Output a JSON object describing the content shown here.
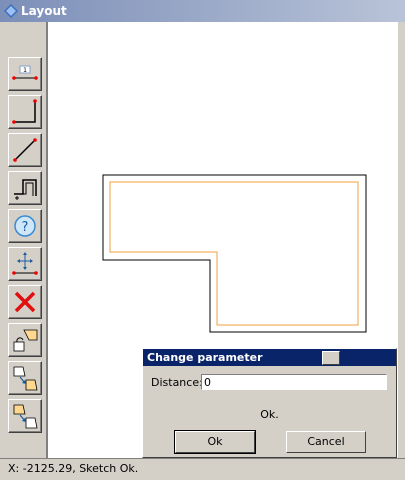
{
  "window": {
    "title": "Layout"
  },
  "toolbar": {
    "tools": [
      {
        "name": "dimension-tool-icon"
      },
      {
        "name": "corner-line-icon"
      },
      {
        "name": "diagonal-line-icon"
      },
      {
        "name": "step-shape-icon"
      },
      {
        "name": "help-icon"
      },
      {
        "name": "move-dimension-icon"
      },
      {
        "name": "delete-icon"
      },
      {
        "name": "shape-rotate-icon"
      },
      {
        "name": "shape-transfer-down-icon"
      },
      {
        "name": "shape-transfer-up-icon"
      }
    ],
    "dimension_badge": "1"
  },
  "dialog": {
    "title": "Change parameter",
    "field_label": "Distance:",
    "field_value": "0",
    "status": "Ok.",
    "ok_label": "Ok",
    "cancel_label": "Cancel"
  },
  "statusbar": {
    "text": "X: -2125.29, Sketch Ok."
  },
  "colors": {
    "outline": "#000000",
    "offset": "#f0a040",
    "dialog_title_bg": "#0a246a"
  }
}
